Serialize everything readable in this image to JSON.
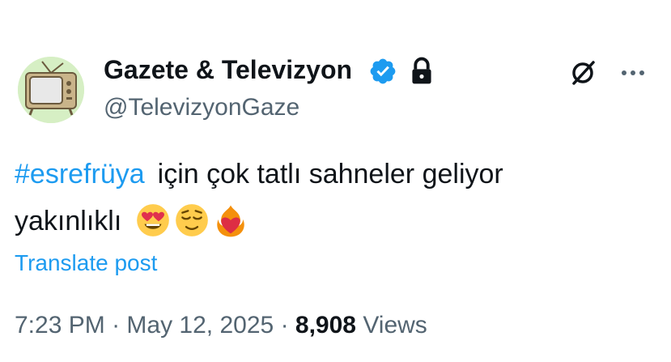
{
  "author": {
    "display_name": "Gazete & Televizyon",
    "handle": "@TelevizyonGaze",
    "verified": true,
    "protected": true,
    "avatar_icon": "retro-tv-icon"
  },
  "header_icons": {
    "grok": "grok-icon",
    "more": "more-dots-icon"
  },
  "post": {
    "hashtag": "#esrefrüya",
    "line1_text": "için çok tatlı sahneler geliyor",
    "line2_text": "yakınlıklı",
    "emojis": [
      "heart-eyes-face",
      "relieved-face",
      "heart-on-fire"
    ],
    "translate_label": "Translate post"
  },
  "meta": {
    "time": "7:23 PM",
    "separator": "·",
    "date": "May 12, 2025",
    "views_count": "8,908",
    "views_label": "Views"
  },
  "colors": {
    "link": "#1d9bf0",
    "text": "#0f1419",
    "muted": "#536471"
  }
}
